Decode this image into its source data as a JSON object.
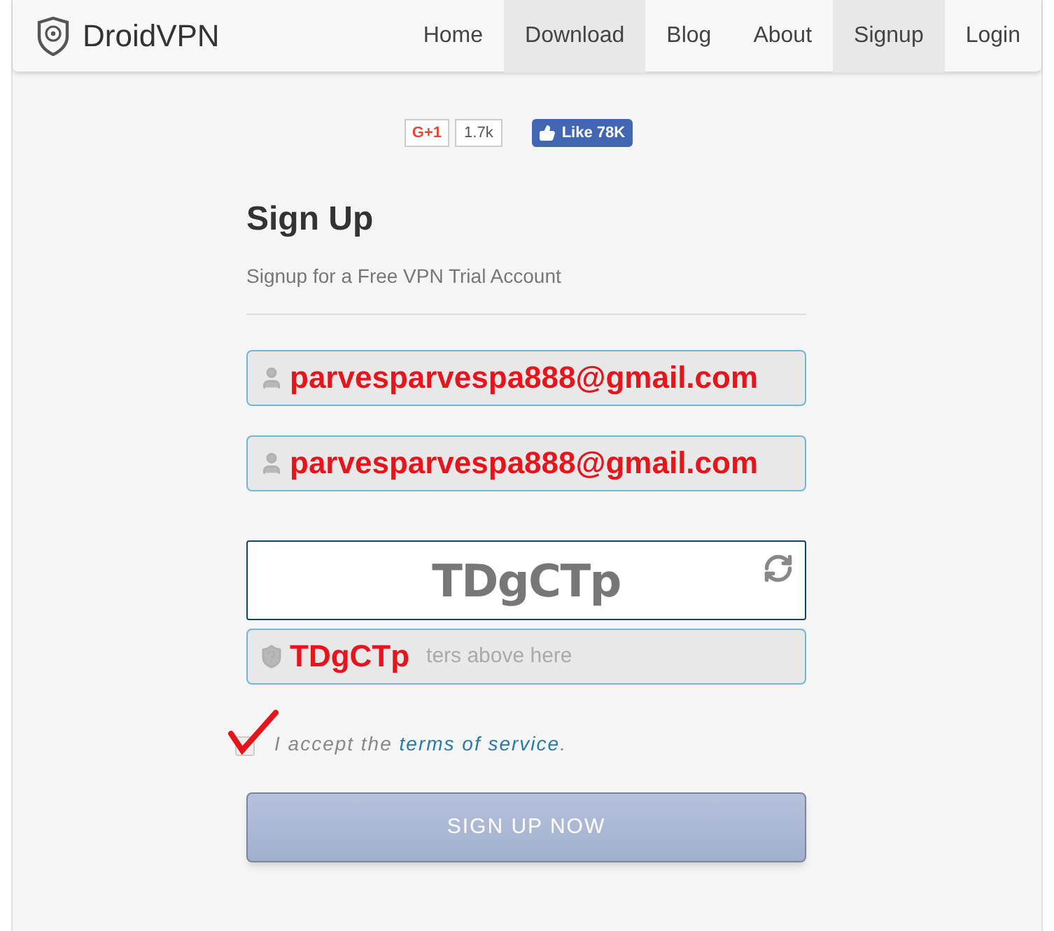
{
  "brand": {
    "name": "DroidVPN"
  },
  "nav": [
    {
      "label": "Home",
      "selected": false
    },
    {
      "label": "Download",
      "selected": true
    },
    {
      "label": "Blog",
      "selected": false
    },
    {
      "label": "About",
      "selected": false
    },
    {
      "label": "Signup",
      "selected": true
    },
    {
      "label": "Login",
      "selected": false
    }
  ],
  "social": {
    "gplus_label": "G+1",
    "gplus_count": "1.7k",
    "fb_label": "Like 78K"
  },
  "form": {
    "title": "Sign Up",
    "subtitle": "Signup for a Free VPN Trial Account",
    "fields": [
      {
        "kind": "user",
        "value": "parvesparvespa888@gmail.com"
      },
      {
        "kind": "user",
        "value": "parvesparvespa888@gmail.com"
      }
    ],
    "captcha": {
      "text": "TDgCTp"
    },
    "captcha_field": {
      "kind": "shield",
      "value": "TDgCTp",
      "placeholder_tail": "ters above here"
    },
    "terms": {
      "checked": true,
      "prefix": "I accept the",
      "link": "terms of service",
      "suffix": "."
    },
    "submit": "SIGN UP NOW"
  }
}
